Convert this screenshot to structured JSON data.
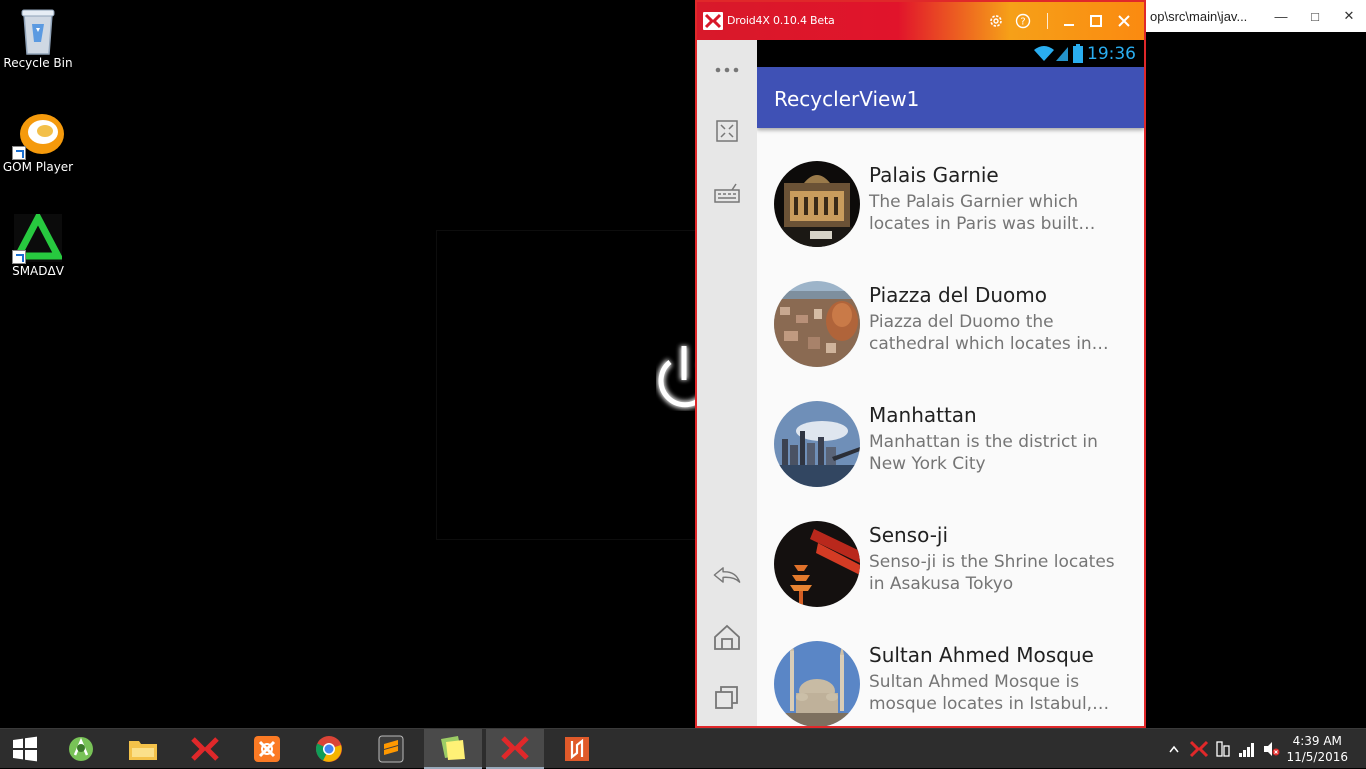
{
  "desktop": {
    "icons": [
      {
        "label": "Recycle Bin",
        "icon": "recycle-bin-icon"
      },
      {
        "label": "GOM Player",
        "icon": "gom-player-icon"
      },
      {
        "label": "SMADΔV",
        "icon": "smadav-icon"
      }
    ]
  },
  "background_window": {
    "title": "op\\src\\main\\jav..."
  },
  "emulator": {
    "title": "Droid4X 0.10.4 Beta",
    "accent": "#e0282a",
    "titlebar_buttons": [
      "settings-icon",
      "help-icon",
      "minimize-icon",
      "maximize-icon",
      "close-icon"
    ],
    "sidebar": [
      "more-icon",
      "fullscreen-icon",
      "keyboard-icon",
      "back-icon",
      "home-icon",
      "recent-apps-icon"
    ]
  },
  "android": {
    "status_time": "19:36",
    "app_title": "RecyclerView1",
    "app_bar_color": "#3f51b5",
    "items": [
      {
        "title": "Palais Garnie",
        "desc": "The Palais Garnier which locates in Paris was built…"
      },
      {
        "title": "Piazza del Duomo",
        "desc": "Piazza del Duomo the cathedral which locates in…"
      },
      {
        "title": "Manhattan",
        "desc": "Manhattan is the district in New York City"
      },
      {
        "title": "Senso-ji",
        "desc": "Senso-ji is the Shrine locates in Asakusa Tokyo"
      },
      {
        "title": "Sultan Ahmed Mosque",
        "desc": "Sultan Ahmed Mosque is mosque locates in Istabul,…"
      }
    ]
  },
  "taskbar": {
    "apps": [
      "windows-start-icon",
      "android-studio-icon",
      "file-explorer-icon",
      "droid4x-icon",
      "xampp-icon",
      "chrome-icon",
      "sublime-text-icon",
      "sticky-notes-icon",
      "droid4x-active-icon",
      "foxit-reader-icon"
    ],
    "clock_time": "4:39 AM",
    "clock_date": "11/5/2016"
  }
}
